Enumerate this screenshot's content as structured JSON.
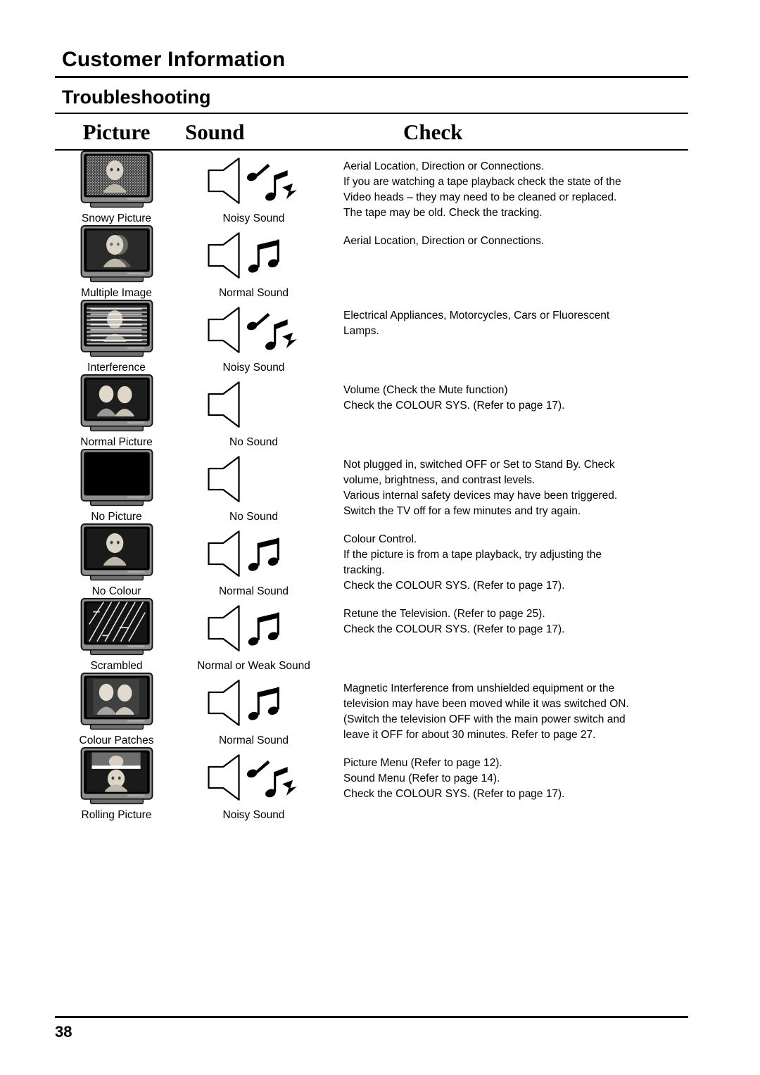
{
  "document": {
    "section_title": "Customer Information",
    "page_title": "Troubleshooting",
    "page_number": "38"
  },
  "columns": {
    "picture": "Picture",
    "sound": "Sound",
    "check": "Check"
  },
  "rows": [
    {
      "picture_icon": "tv-snowy-picture",
      "picture_caption": "Snowy Picture",
      "sound_icon": "speaker-noisy-sound",
      "sound_caption": "Noisy Sound",
      "check_lines": [
        "Aerial Location, Direction or Connections.",
        "If you are watching a tape playback check the state of the",
        "Video heads – they may need to be cleaned or replaced.",
        "The tape may be old. Check the tracking."
      ]
    },
    {
      "picture_icon": "tv-multiple-image",
      "picture_caption": "Multiple Image",
      "sound_icon": "speaker-normal-sound",
      "sound_caption": "Normal Sound",
      "check_lines": [
        "Aerial Location, Direction or Connections."
      ]
    },
    {
      "picture_icon": "tv-interference",
      "picture_caption": "Interference",
      "sound_icon": "speaker-noisy-sound",
      "sound_caption": "Noisy Sound",
      "check_lines": [
        "Electrical Appliances, Motorcycles, Cars or Fluorescent",
        "Lamps."
      ]
    },
    {
      "picture_icon": "tv-normal-picture",
      "picture_caption": "Normal Picture",
      "sound_icon": "speaker-no-sound",
      "sound_caption": "No Sound",
      "check_lines": [
        "Volume (Check the Mute function)",
        "Check the COLOUR SYS.  (Refer to page  17)."
      ]
    },
    {
      "picture_icon": "tv-no-picture",
      "picture_caption": "No Picture",
      "sound_icon": "speaker-no-sound",
      "sound_caption": "No Sound",
      "check_lines": [
        "Not plugged in, switched OFF or Set to Stand By. Check",
        "volume, brightness, and contrast levels.",
        "Various internal safety devices may have been triggered.",
        "Switch the TV off for a few minutes and try again."
      ]
    },
    {
      "picture_icon": "tv-no-colour",
      "picture_caption": "No Colour",
      "sound_icon": "speaker-normal-sound",
      "sound_caption": "Normal Sound",
      "check_lines": [
        "Colour Control.",
        "If the picture is from a tape playback, try adjusting the",
        "tracking.",
        "Check the COLOUR SYS.  (Refer to page  17)."
      ]
    },
    {
      "picture_icon": "tv-scrambled",
      "picture_caption": "Scrambled",
      "sound_icon": "speaker-normal-sound",
      "sound_caption": "Normal or Weak Sound",
      "check_lines": [
        "Retune the Television.  (Refer to page 25).",
        "Check the COLOUR SYS.  (Refer to page  17)."
      ]
    },
    {
      "picture_icon": "tv-colour-patches",
      "picture_caption": "Colour Patches",
      "sound_icon": "speaker-normal-sound",
      "sound_caption": "Normal Sound",
      "check_lines": [
        "Magnetic Interference from unshielded equipment or the",
        "television may have been moved while it was switched ON.",
        "(Switch the television OFF with the main power switch and",
        "leave it OFF for about 30 minutes. Refer to page  27."
      ]
    },
    {
      "picture_icon": "tv-rolling-picture",
      "picture_caption": "Rolling Picture",
      "sound_icon": "speaker-noisy-sound",
      "sound_caption": "Noisy Sound",
      "check_lines": [
        "Picture Menu (Refer to page 12).",
        "Sound Menu (Refer to page 14).",
        "Check the COLOUR SYS. (Refer to page  17)."
      ]
    }
  ]
}
